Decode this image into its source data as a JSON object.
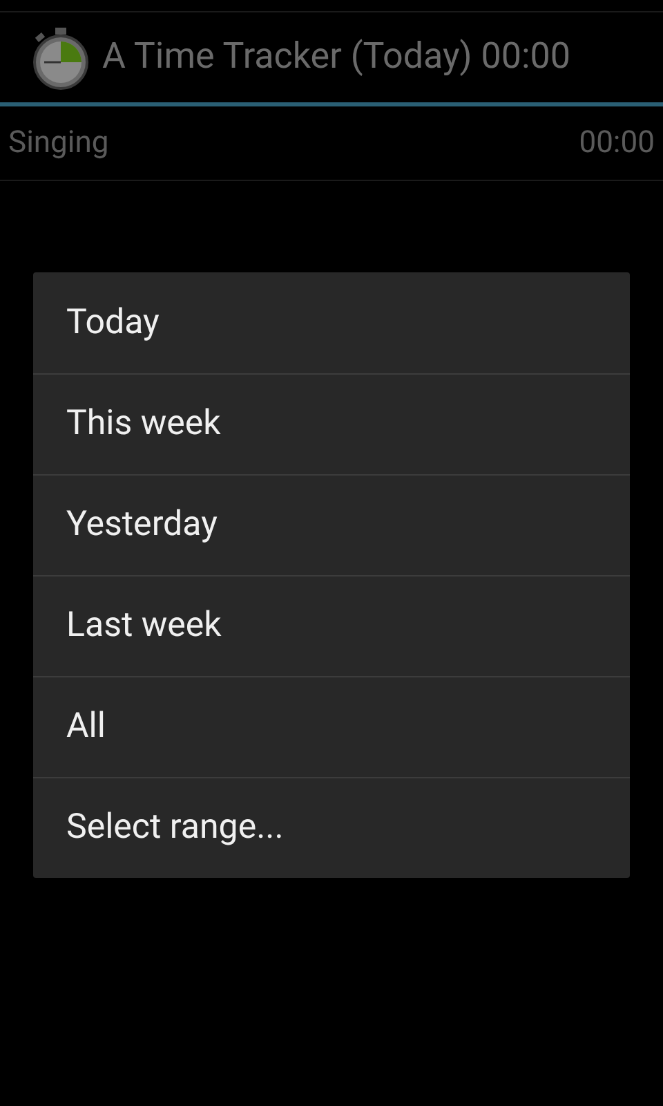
{
  "action_bar": {
    "title": "A Time Tracker (Today) 00:00"
  },
  "tasks": [
    {
      "name": "Singing",
      "time": "00:00"
    }
  ],
  "dialog": {
    "items": [
      {
        "label": "Today"
      },
      {
        "label": "This week"
      },
      {
        "label": "Yesterday"
      },
      {
        "label": "Last week"
      },
      {
        "label": "All"
      },
      {
        "label": "Select range..."
      }
    ]
  }
}
